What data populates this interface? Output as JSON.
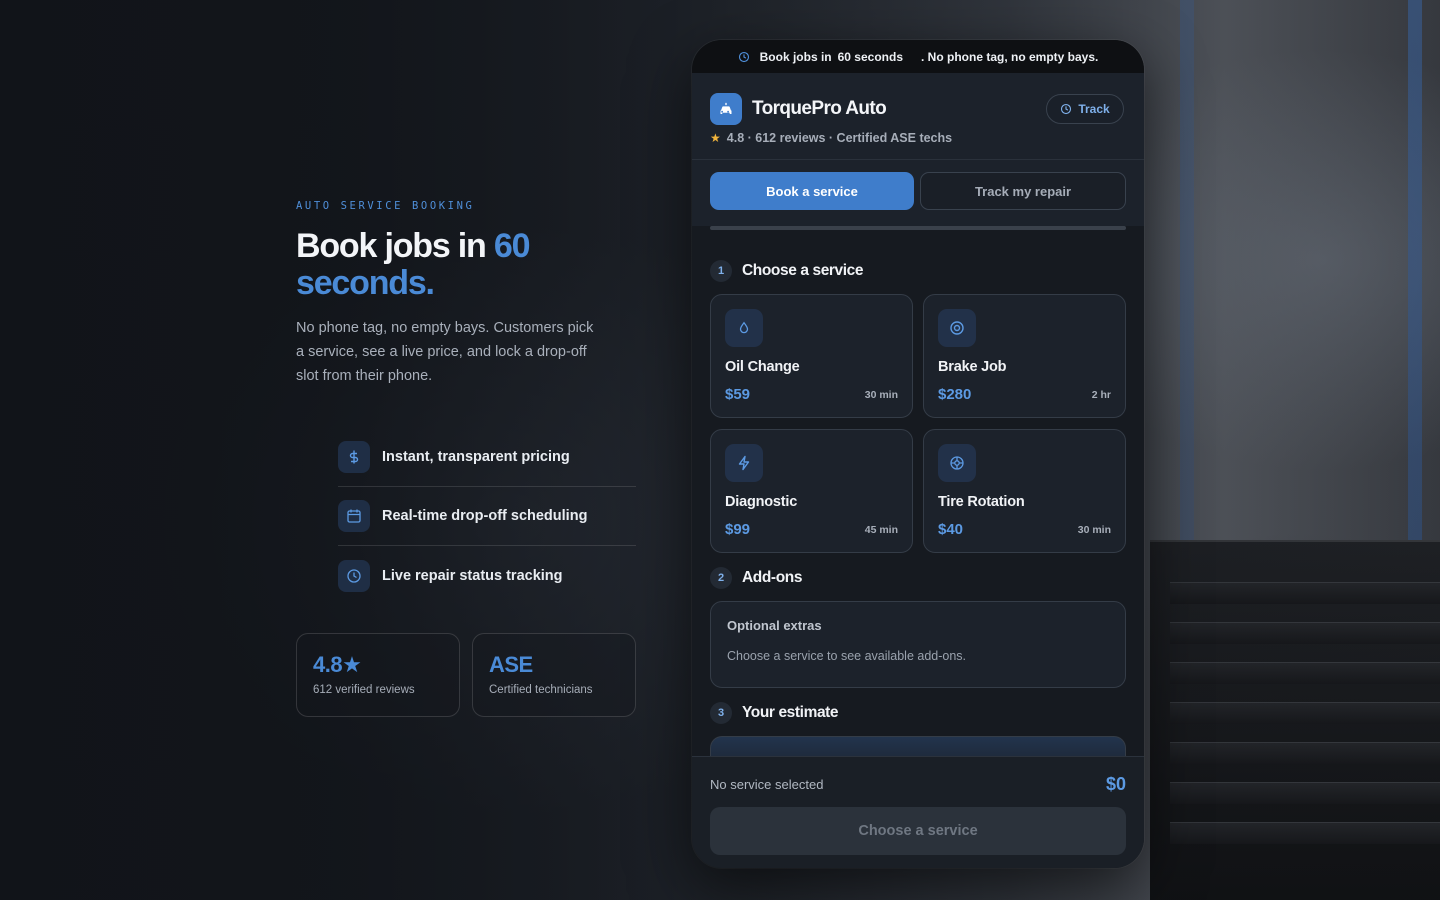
{
  "hero": {
    "eyebrow": "AUTO SERVICE BOOKING",
    "headline_prefix": "Book jobs in ",
    "headline_accent": "60 seconds.",
    "lede": "No phone tag, no empty bays. Customers pick a service, see a live price, and lock a drop-off slot from their phone.",
    "features": [
      {
        "icon": "dollar-icon",
        "label": "Instant, transparent pricing"
      },
      {
        "icon": "calendar-icon",
        "label": "Real-time drop-off scheduling"
      },
      {
        "icon": "clock-icon",
        "label": "Live repair status tracking"
      }
    ],
    "stats": [
      {
        "value": "4.8★",
        "label": "612 verified reviews"
      },
      {
        "value": "ASE",
        "label": "Certified technicians"
      }
    ]
  },
  "phone": {
    "banner": {
      "part1": "Book jobs in",
      "part2": "60 seconds",
      "part3": ". No phone tag, no empty bays."
    },
    "brand": {
      "name": "TorquePro Auto",
      "rating": "4.8 · 612 reviews · Certified ASE techs"
    },
    "track_label": "Track",
    "tabs": [
      {
        "label": "Book a service",
        "active": true
      },
      {
        "label": "Track my repair",
        "active": false
      }
    ],
    "steps": [
      {
        "num": "1",
        "title": "Choose a service"
      },
      {
        "num": "2",
        "title": "Add-ons"
      },
      {
        "num": "3",
        "title": "Your estimate"
      }
    ],
    "services": [
      {
        "name": "Oil Change",
        "price": "$59",
        "duration": "30 min",
        "icon": "droplet-icon"
      },
      {
        "name": "Brake Job",
        "price": "$280",
        "duration": "2 hr",
        "icon": "disc-icon"
      },
      {
        "name": "Diagnostic",
        "price": "$99",
        "duration": "45 min",
        "icon": "lightning-icon"
      },
      {
        "name": "Tire Rotation",
        "price": "$40",
        "duration": "30 min",
        "icon": "tire-icon"
      }
    ],
    "addons": {
      "title": "Optional extras",
      "note": "Choose a service to see available add-ons."
    },
    "footer": {
      "status": "No service selected",
      "total": "$0",
      "cta": "Choose a service"
    }
  },
  "colors": {
    "accent": "#4a8ad6",
    "star": "#f0b43c",
    "background": "#15181d"
  }
}
